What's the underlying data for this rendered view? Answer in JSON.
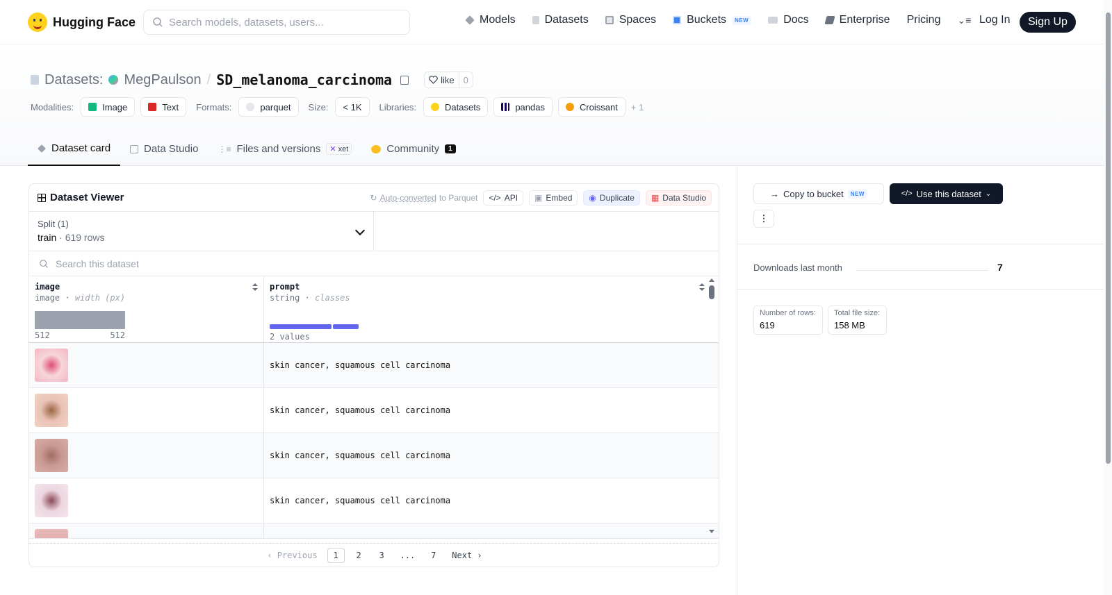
{
  "nav": {
    "logo_text": "Hugging Face",
    "search_placeholder": "Search models, datasets, users...",
    "links": [
      {
        "label": "Models",
        "icon": "cube-icon",
        "color": "#6b7280"
      },
      {
        "label": "Datasets",
        "icon": "database-icon",
        "color": "#9ca3af"
      },
      {
        "label": "Spaces",
        "icon": "spaces-grid-icon",
        "color": "#9ca3af"
      },
      {
        "label": "Buckets",
        "icon": "bucket-icon",
        "color": "#3b82f6"
      },
      {
        "label": "Docs",
        "icon": "book-icon",
        "color": "#9ca3af"
      },
      {
        "label": "Enterprise",
        "icon": "enterprise-icon",
        "color": "#6b7280"
      },
      {
        "label": "Pricing"
      }
    ],
    "buckets_badge": "NEW",
    "menu_icon": "menu-icon",
    "login": "Log In",
    "signup": "Sign Up"
  },
  "header": {
    "datasets_label": "Datasets:",
    "owner": "MegPaulson",
    "separator": "/",
    "name": "SD_melanoma_carcinoma",
    "like_label": "like",
    "like_count": "0",
    "modalities_label": "Modalities:",
    "modalities": [
      "Image",
      "Text"
    ],
    "formats_label": "Formats:",
    "formats": [
      "parquet"
    ],
    "size_label": "Size:",
    "size": "< 1K",
    "libraries_label": "Libraries:",
    "libraries": [
      "Datasets",
      "pandas",
      "Croissant"
    ],
    "libraries_more": "+ 1"
  },
  "tabs": [
    {
      "label": "Dataset card",
      "active": true
    },
    {
      "label": "Data Studio"
    },
    {
      "label": "Files and versions",
      "badge": "xet"
    },
    {
      "label": "Community",
      "badge": "1"
    }
  ],
  "viewer": {
    "title": "Dataset Viewer",
    "auto_converted_link": "Auto-converted",
    "auto_converted_suffix": "to Parquet",
    "api": "API",
    "embed": "Embed",
    "duplicate": "Duplicate",
    "data_studio": "Data Studio",
    "split_label": "Split (1)",
    "split_value": "train",
    "split_dot": "·",
    "split_rows": "619 rows",
    "search_placeholder": "Search this dataset",
    "columns": [
      {
        "name": "image",
        "type": "image",
        "stat": "width (px)",
        "min": "512",
        "max": "512"
      },
      {
        "name": "prompt",
        "type": "string",
        "stat": "classes",
        "values_label": "2 values",
        "class_fractions": [
          0.7,
          0.3
        ]
      }
    ],
    "type_sep": "·",
    "rows": [
      {
        "prompt": "skin cancer, squamous cell carcinoma",
        "thumb_colors": [
          "#f7d6da",
          "#e04d7a",
          "#f3b6c3"
        ]
      },
      {
        "prompt": "skin cancer, squamous cell carcinoma",
        "thumb_colors": [
          "#e9c2b5",
          "#9a6544",
          "#f1d2c6"
        ]
      },
      {
        "prompt": "skin cancer, squamous cell carcinoma",
        "thumb_colors": [
          "#c99a92",
          "#a56c66",
          "#d8aea6"
        ]
      },
      {
        "prompt": "skin cancer, squamous cell carcinoma",
        "thumb_colors": [
          "#ecd6e0",
          "#8c4a5a",
          "#f5e4ec"
        ]
      }
    ],
    "pager": {
      "previous": "Previous",
      "pages": [
        "1",
        "2",
        "3",
        "...",
        "7"
      ],
      "current": "1",
      "next": "Next"
    }
  },
  "sidebar": {
    "copy_to_bucket": "Copy to bucket",
    "copy_badge": "NEW",
    "use_dataset": "Use this dataset",
    "more": "⋮",
    "downloads_label": "Downloads last month",
    "downloads_value": "7",
    "stats": [
      {
        "label": "Number of rows:",
        "value": "619"
      },
      {
        "label": "Total file size:",
        "value": "158 MB"
      }
    ]
  },
  "colors": {
    "accent_dark": "#111827",
    "class_bar": "#6366f1",
    "histogram": "#9ca3af"
  }
}
